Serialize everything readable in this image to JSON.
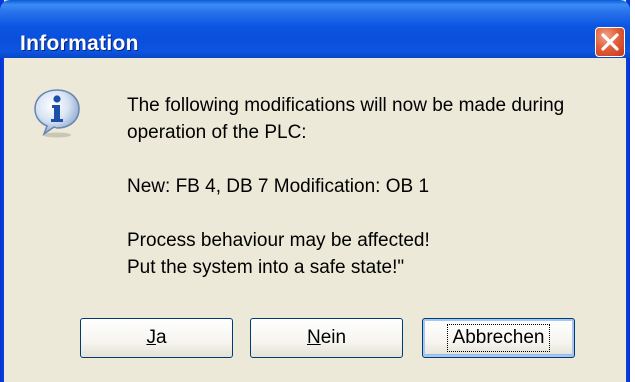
{
  "window": {
    "title": "Information"
  },
  "message": {
    "line1": "The following modifications will now be made during",
    "line2": "operation of the PLC:",
    "line3": "New: FB 4, DB 7   Modification: OB 1",
    "line4": "Process behaviour may be affected!",
    "line5": "Put the system into a safe state!\""
  },
  "buttons": {
    "yes": {
      "label_first": "J",
      "label_rest": "a"
    },
    "no": {
      "label_first": "N",
      "label_rest": "ein"
    },
    "cancel": {
      "label": "Abbrechen"
    }
  },
  "icons": {
    "info": "info-icon",
    "close": "close-icon"
  },
  "colors": {
    "titlebar": "#0a4fdc",
    "client_bg": "#ece9d8",
    "close_button": "#e1603b",
    "button_border": "#003c74"
  }
}
